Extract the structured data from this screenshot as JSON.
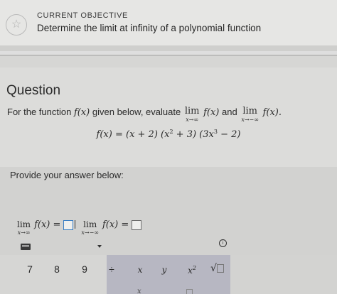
{
  "objective": {
    "label": "CURRENT OBJECTIVE",
    "title": "Determine the limit at infinity of a polynomial function",
    "icon": "star-icon"
  },
  "question": {
    "heading": "Question",
    "prompt_start": "For the function",
    "func_name": "f(x)",
    "prompt_mid": "given below, evaluate",
    "lim1_word": "lim",
    "lim1_sub": "x→∞",
    "lim1_expr": "f(x)",
    "and_word": "and",
    "lim2_word": "lim",
    "lim2_sub": "x→−∞",
    "lim2_expr": "f(x).",
    "formula_lhs": "f(x) = (x + 2) (x",
    "formula_exp1": "2",
    "formula_mid": " + 3) (3x",
    "formula_exp2": "3",
    "formula_end": " − 2)"
  },
  "answer": {
    "label": "Provide your answer below:",
    "lim1_word": "lim",
    "lim1_sub": "x→∞",
    "lim1_expr": "f(x) =",
    "lim2_word": "lim",
    "lim2_sub": "x→−∞",
    "lim2_expr": "f(x) =",
    "value1": "",
    "value2": ""
  },
  "keypad": {
    "keys": [
      "7",
      "8",
      "9",
      "÷",
      "x",
      "y",
      "x²"
    ],
    "key_x": "x",
    "key_y": "y",
    "key_x2_base": "x",
    "key_x2_exp": "2",
    "ghost_key": "x",
    "info_glyph": "i"
  }
}
